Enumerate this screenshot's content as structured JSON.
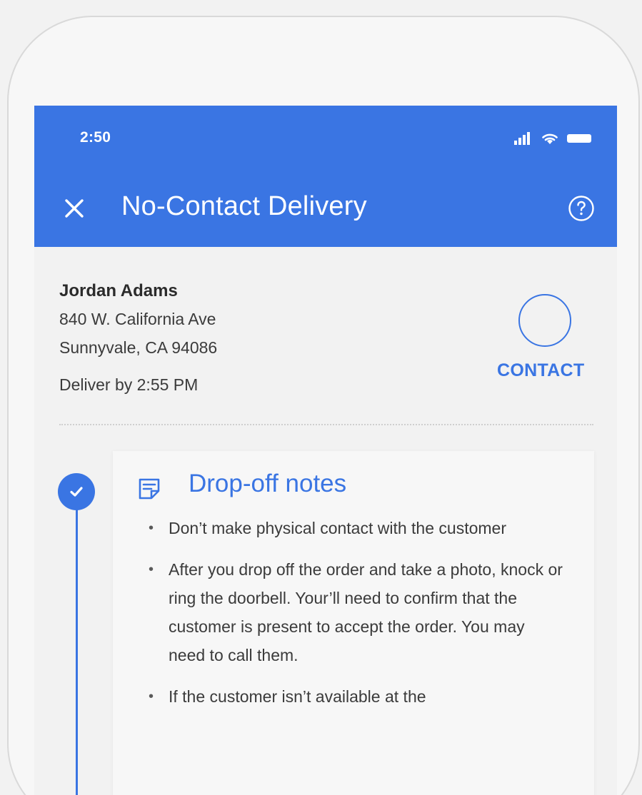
{
  "status_bar": {
    "time": "2:50",
    "icons": [
      "signal-icon",
      "wifi-icon",
      "battery-icon"
    ]
  },
  "header": {
    "title": "No-Contact Delivery",
    "close_icon": "close-icon",
    "help_icon": "help-icon",
    "background_color": "#3a75e3"
  },
  "customer": {
    "name": "Jordan Adams",
    "address_line1": "840 W. California Ave",
    "address_line2": "Sunnyvale, CA 94086",
    "deliver_by": "Deliver by 2:55 PM",
    "contact_label": "CONTACT"
  },
  "dropoff": {
    "title": "Drop-off notes",
    "icon": "notes-icon",
    "step_status": "completed",
    "notes": [
      "Don’t make physical contact with the customer",
      "After you drop off the order and take a photo, knock or ring the doorbell. Your’ll need to confirm that the customer is present to accept the order. You may need to call them.",
      "If the customer isn’t available at the"
    ]
  },
  "colors": {
    "accent": "#3a75e3",
    "text_primary": "#2b2b2b",
    "text_secondary": "#3b3b3b"
  }
}
